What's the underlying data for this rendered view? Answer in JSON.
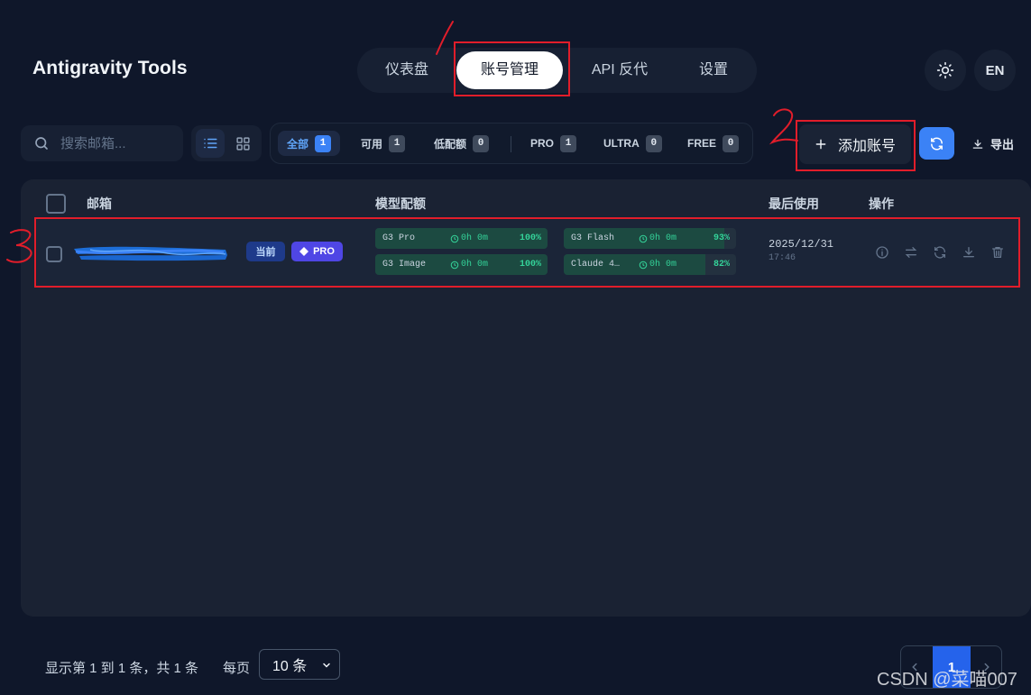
{
  "app": {
    "title": "Antigravity Tools"
  },
  "nav": {
    "tabs": [
      {
        "label": "仪表盘",
        "active": false
      },
      {
        "label": "账号管理",
        "active": true
      },
      {
        "label": "API 反代",
        "active": false
      },
      {
        "label": "设置",
        "active": false
      }
    ]
  },
  "header": {
    "theme_icon": "sun-icon",
    "language": "EN"
  },
  "toolbar": {
    "search_placeholder": "搜索邮箱...",
    "view_modes": [
      "list-icon",
      "grid-icon"
    ],
    "filters": [
      {
        "label": "全部",
        "count": "1",
        "active": true
      },
      {
        "label": "可用",
        "count": "1",
        "active": false
      },
      {
        "label": "低配额",
        "count": "0",
        "active": false
      },
      {
        "label": "PRO",
        "count": "1",
        "active": false
      },
      {
        "label": "ULTRA",
        "count": "0",
        "active": false
      },
      {
        "label": "FREE",
        "count": "0",
        "active": false
      }
    ],
    "add_label": "添加账号",
    "export_label": "导出"
  },
  "table": {
    "headers": {
      "email": "邮箱",
      "quota": "模型配额",
      "last_used": "最后使用",
      "actions": "操作"
    },
    "rows": [
      {
        "current_tag": "当前",
        "plan_tag": "PRO",
        "quotas": [
          {
            "model": "G3 Pro",
            "reset": "0h 0m",
            "percent": "100%",
            "level": 1.0
          },
          {
            "model": "G3 Flash",
            "reset": "0h 0m",
            "percent": "93%",
            "level": 0.93
          },
          {
            "model": "G3 Image",
            "reset": "0h 0m",
            "percent": "100%",
            "level": 1.0
          },
          {
            "model": "Claude 4…",
            "reset": "0h 0m",
            "percent": "82%",
            "level": 0.82
          }
        ],
        "last_used_date": "2025/12/31",
        "last_used_time": "17:46",
        "action_icons": [
          "info-icon",
          "switch-icon",
          "refresh-icon",
          "download-icon",
          "trash-icon"
        ]
      }
    ]
  },
  "footer": {
    "summary": "显示第 1 到 1 条，共 1 条",
    "per_page_label": "每页",
    "per_page_value": "10 条",
    "current_page": "1"
  },
  "annotations": [
    "1",
    "2",
    "3"
  ],
  "watermark": "CSDN @菜喵007",
  "colors": {
    "accent": "#3b82f6",
    "annotation": "#e11d2a",
    "quota_ok": "#34d399",
    "background": "#0f172a"
  }
}
